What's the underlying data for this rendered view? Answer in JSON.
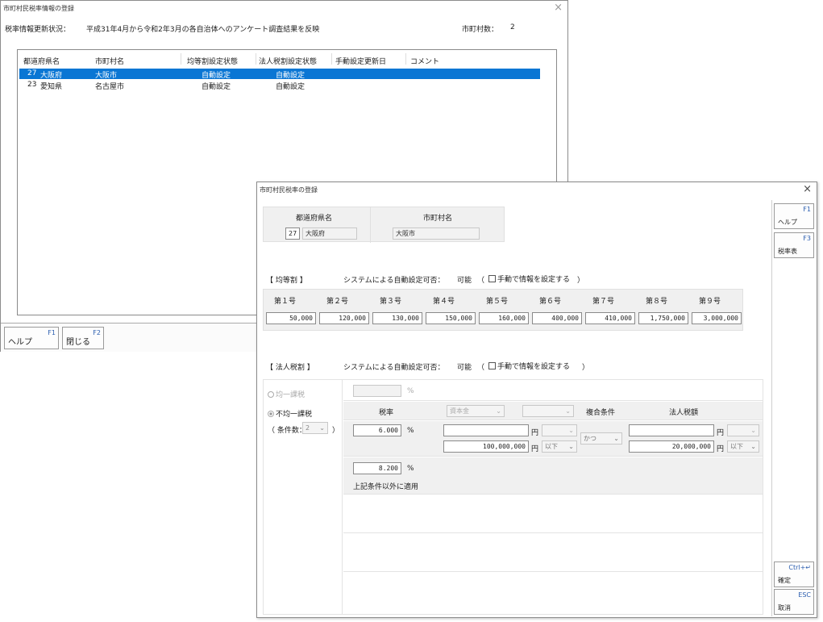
{
  "back": {
    "title": "市町村民税率情報の登録",
    "status_label": "税率情報更新状況：",
    "status_text": "平成31年4月から令和2年3月の各自治体へのアンケート調査結果を反映",
    "count_label": "市町村数：",
    "count_value": "2",
    "columns": [
      "都道府県名",
      "市町村名",
      "均等割設定状態",
      "法人税割設定状態",
      "手動設定更新日",
      "コメント"
    ],
    "rows": [
      {
        "pref_code": "27",
        "pref": "大阪府",
        "city": "大阪市",
        "kin": "自動設定",
        "hojin": "自動設定",
        "date": "",
        "comment": ""
      },
      {
        "pref_code": "23",
        "pref": "愛知県",
        "city": "名古屋市",
        "kin": "自動設定",
        "hojin": "自動設定",
        "date": "",
        "comment": ""
      }
    ],
    "f1_key": "F1",
    "f1_label": "ヘルプ",
    "f2_key": "F2",
    "f2_label": "閉じる"
  },
  "front": {
    "title": "市町村民税率の登録",
    "pref_header": "都道府県名",
    "city_header": "市町村名",
    "pref_code": "27",
    "pref_name": "大阪府",
    "city_name": "大阪市",
    "kinto": {
      "section": "【 均等割 】",
      "auto_label": "システムによる自動設定可否：",
      "auto_value": "可能",
      "paren_open": "（",
      "manual_check": "手動で情報を設定する",
      "paren_close": "）",
      "headers": [
        "第１号",
        "第２号",
        "第３号",
        "第４号",
        "第５号",
        "第６号",
        "第７号",
        "第８号",
        "第９号"
      ],
      "values": [
        "50,000",
        "120,000",
        "130,000",
        "150,000",
        "160,000",
        "400,000",
        "410,000",
        "1,750,000",
        "3,000,000"
      ]
    },
    "hojin": {
      "section": "【 法人税割 】",
      "auto_label": "システムによる自動設定可否：",
      "auto_value": "可能",
      "paren_open": "（",
      "manual_check": "手動で情報を設定する",
      "paren_close": "）",
      "uniform_label": "均一課税",
      "nonuniform_label": "不均一課税",
      "cond_label": "（ 条件数：",
      "cond_value": "2",
      "cond_close": "）",
      "pct": "%",
      "col_rate": "税率",
      "col_base": "資本金",
      "col_combine": "複合条件",
      "col_hojin": "法人税額",
      "rate1": "6.000",
      "yen": "円",
      "amount1": "100,000,000",
      "below": "以下",
      "combine_value": "かつ",
      "amount2": "20,000,000",
      "rate2": "8.200",
      "other_note": "上記条件以外に適用"
    },
    "side": {
      "f1_key": "F1",
      "f1_label": "ヘルプ",
      "f3_key": "F3",
      "f3_label": "税率表",
      "ctrl_key": "Ctrl+↵",
      "ctrl_label": "確定",
      "esc_key": "ESC",
      "esc_label": "取消"
    },
    "close_glyph": "×"
  },
  "back_close_glyph": "×"
}
